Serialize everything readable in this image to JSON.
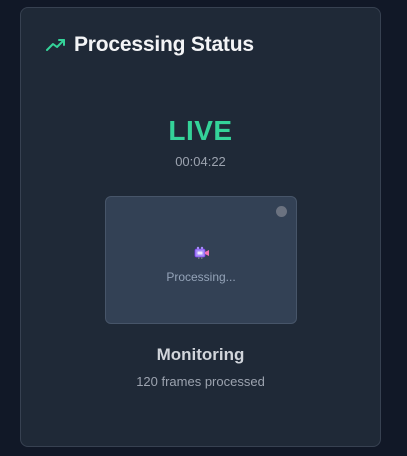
{
  "header": {
    "title": "Processing Status",
    "icon": "trending-up-icon"
  },
  "status": {
    "label": "LIVE",
    "elapsed": "00:04:22"
  },
  "preview": {
    "icon": "video-camera-icon",
    "text": "Processing..."
  },
  "summary": {
    "mode": "Monitoring",
    "frames": "120 frames processed"
  },
  "colors": {
    "background": "#111827",
    "card": "#1f2937",
    "live": "#34d399",
    "accent": "#34d399"
  }
}
